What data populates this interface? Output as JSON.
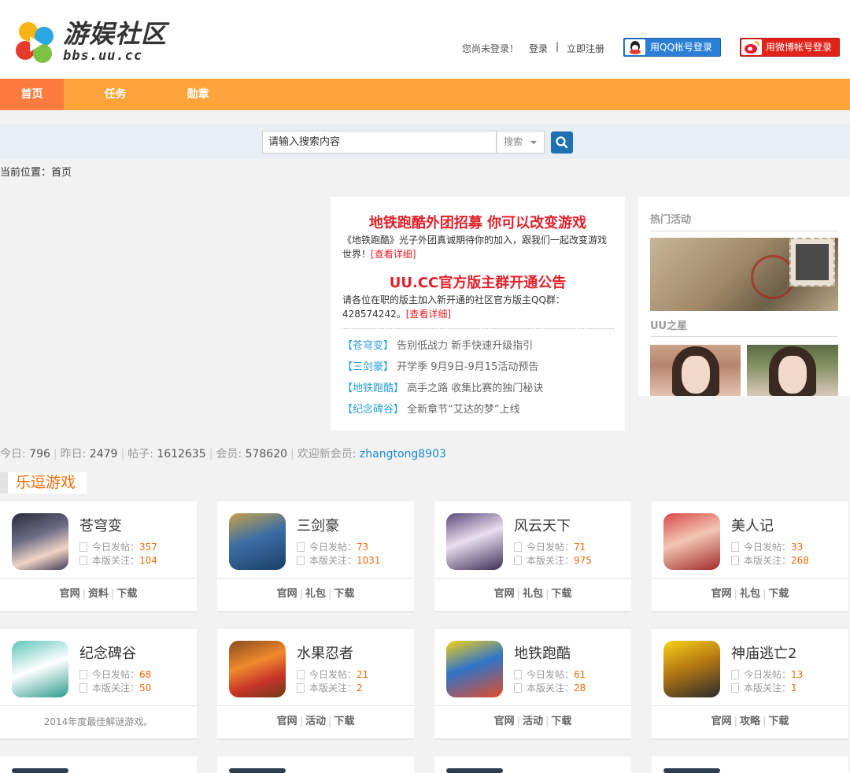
{
  "header": {
    "logo_title": "游娱社区",
    "logo_sub": "bbs.uu.cc",
    "login_status": "您尚未登录！",
    "login_link": "登录",
    "register_link": "立即注册",
    "sep": "|",
    "qq_login": "用QQ帐号登录",
    "weibo_login": "用微博帐号登录"
  },
  "nav": {
    "items": [
      {
        "label": "首页"
      },
      {
        "label": "任务"
      },
      {
        "label": "勋章"
      }
    ]
  },
  "search": {
    "placeholder": "请输入搜索内容",
    "scope": "搜索"
  },
  "breadcrumb": {
    "label": "当前位置：",
    "current": "首页"
  },
  "news": {
    "headline1": "地铁跑酷外团招募 你可以改变游戏",
    "text1": "《地铁跑酷》光子外团真诚期待你的加入，跟我们一起改变游戏世界！",
    "headline2": "UU.CC官方版主群开通公告",
    "text2": "请各位在职的版主加入新开通的社区官方版主QQ群：428574242。",
    "more": "[查看详细]",
    "list": [
      {
        "tag": "【苍穹变】",
        "text": "告别低战力 新手快速升级指引"
      },
      {
        "tag": "【三剑豪】",
        "text": "开学季 9月9日-9月15活动预告"
      },
      {
        "tag": "【地铁跑酷】",
        "text": "高手之路 收集比赛的独门秘诀"
      },
      {
        "tag": "【纪念碑谷】",
        "text": "全新章节“艾达的梦”上线"
      }
    ]
  },
  "side": {
    "hot_title": "热门活动",
    "star_title": "UU之星"
  },
  "stats": {
    "today_label": "今日:",
    "today": "796",
    "yesterday_label": "昨日:",
    "yesterday": "2479",
    "posts_label": "帖子:",
    "posts": "1612635",
    "members_label": "会员:",
    "members": "578620",
    "welcome_label": "欢迎新会员:",
    "new_member": "zhangtong8903"
  },
  "section": {
    "title": "乐逗游戏"
  },
  "cards_labels": {
    "today": "今日发帖：",
    "follow": "本版关注："
  },
  "cards": [
    {
      "name": "苍穹变",
      "today": "357",
      "follow": "104",
      "links": [
        "官网",
        "资料",
        "下载"
      ]
    },
    {
      "name": "三剑豪",
      "today": "73",
      "follow": "1031",
      "links": [
        "官网",
        "礼包",
        "下载"
      ]
    },
    {
      "name": "风云天下",
      "today": "71",
      "follow": "975",
      "links": [
        "官网",
        "礼包",
        "下载"
      ]
    },
    {
      "name": "美人记",
      "today": "33",
      "follow": "268",
      "links": [
        "官网",
        "礼包",
        "下载"
      ]
    },
    {
      "name": "纪念碑谷",
      "today": "68",
      "follow": "50",
      "note": "2014年度最佳解谜游戏。"
    },
    {
      "name": "水果忍者",
      "today": "21",
      "follow": "2",
      "links": [
        "官网",
        "活动",
        "下载"
      ]
    },
    {
      "name": "地铁跑酷",
      "today": "61",
      "follow": "28",
      "links": [
        "官网",
        "活动",
        "下载"
      ]
    },
    {
      "name": "神庙逃亡2",
      "today": "13",
      "follow": "1",
      "links": [
        "官网",
        "攻略",
        "下载"
      ]
    }
  ],
  "colors": {
    "nav": "#fea43a",
    "nav_active": "#fd7b3c",
    "headline": "#e3212a",
    "accent": "#f66a0a",
    "link": "#2aa0d8"
  }
}
